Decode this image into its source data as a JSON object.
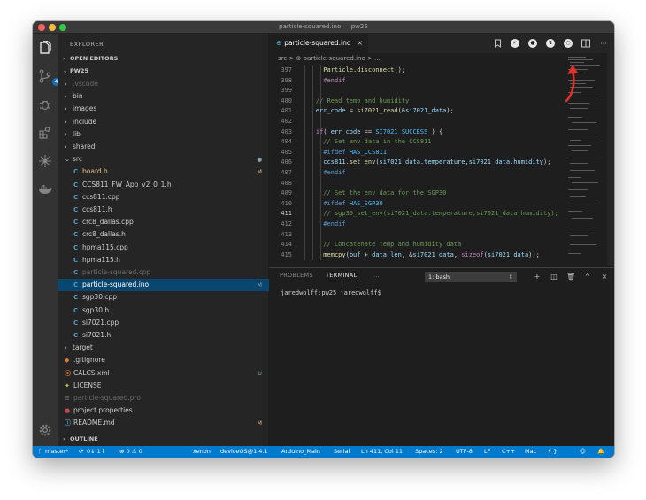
{
  "window": {
    "title": "particle-squared.ino — pw25"
  },
  "sidebar": {
    "header": "EXPLORER",
    "sections": {
      "open_editors": "OPEN EDITORS",
      "project": "PW25",
      "outline": "OUTLINE"
    },
    "tree": [
      {
        "name": ".vscode",
        "type": "folder",
        "muted": true
      },
      {
        "name": "bin",
        "type": "folder"
      },
      {
        "name": "images",
        "type": "folder"
      },
      {
        "name": "include",
        "type": "folder"
      },
      {
        "name": "lib",
        "type": "folder"
      },
      {
        "name": "shared",
        "type": "folder"
      },
      {
        "name": "src",
        "type": "folder-open",
        "status": "●"
      },
      {
        "name": "board.h",
        "type": "c",
        "status": "M",
        "modified": true
      },
      {
        "name": "CCS811_FW_App_v2_0_1.h",
        "type": "c"
      },
      {
        "name": "ccs811.cpp",
        "type": "c"
      },
      {
        "name": "ccs811.h",
        "type": "c"
      },
      {
        "name": "crc8_dallas.cpp",
        "type": "c"
      },
      {
        "name": "crc8_dallas.h",
        "type": "c"
      },
      {
        "name": "hpma115.cpp",
        "type": "c"
      },
      {
        "name": "hpma115.h",
        "type": "c"
      },
      {
        "name": "particle-squared.cpp",
        "type": "c",
        "muted": true
      },
      {
        "name": "particle-squared.ino",
        "type": "c",
        "status": "M",
        "selected": true
      },
      {
        "name": "sgp30.cpp",
        "type": "c"
      },
      {
        "name": "sgp30.h",
        "type": "c"
      },
      {
        "name": "si7021.cpp",
        "type": "c"
      },
      {
        "name": "si7021.h",
        "type": "c"
      },
      {
        "name": "target",
        "type": "folder"
      },
      {
        "name": ".gitignore",
        "type": "git"
      },
      {
        "name": "CALCS.xml",
        "type": "xml",
        "status": "U"
      },
      {
        "name": "LICENSE",
        "type": "license"
      },
      {
        "name": "particle-squared.pro",
        "type": "other",
        "muted": true
      },
      {
        "name": "project.properties",
        "type": "props"
      },
      {
        "name": "README.md",
        "type": "md",
        "status": "M"
      }
    ]
  },
  "editor": {
    "tab": {
      "label": "particle-squared.ino",
      "close": "×"
    },
    "breadcrumb": "src > ⊕ particle-squared.ino > ...",
    "lines": [
      {
        "n": "397",
        "segs": [
          [
            "tx",
            "      "
          ],
          [
            "fn",
            "Particle.disconnect"
          ],
          [
            "tx",
            "();"
          ]
        ]
      },
      {
        "n": "398",
        "segs": [
          [
            "tx",
            "      "
          ],
          [
            "kw",
            "#endif"
          ]
        ]
      },
      {
        "n": "399",
        "segs": [
          [
            "tx",
            ""
          ]
        ]
      },
      {
        "n": "400",
        "segs": [
          [
            "tx",
            "    "
          ],
          [
            "cm",
            "// Read temp and humidity"
          ]
        ]
      },
      {
        "n": "401",
        "segs": [
          [
            "tx",
            "    "
          ],
          [
            "id",
            "err_code"
          ],
          [
            "tx",
            " = "
          ],
          [
            "fn",
            "si7021_read"
          ],
          [
            "tx",
            "(&"
          ],
          [
            "id",
            "si7021_data"
          ],
          [
            "tx",
            ");"
          ]
        ]
      },
      {
        "n": "402",
        "segs": [
          [
            "tx",
            ""
          ]
        ]
      },
      {
        "n": "403",
        "segs": [
          [
            "tx",
            "    "
          ],
          [
            "kw",
            "if"
          ],
          [
            "tx",
            "( "
          ],
          [
            "id",
            "err_code"
          ],
          [
            "tx",
            " == "
          ],
          [
            "mc",
            "SI7021_SUCCESS"
          ],
          [
            "tx",
            " ) {"
          ]
        ]
      },
      {
        "n": "404",
        "segs": [
          [
            "tx",
            "      "
          ],
          [
            "cm",
            "// Set env data in the CCS811"
          ]
        ]
      },
      {
        "n": "405",
        "segs": [
          [
            "tx",
            "      "
          ],
          [
            "pp",
            "#ifdef"
          ],
          [
            "tx",
            " "
          ],
          [
            "mc",
            "HAS_CCS811"
          ]
        ]
      },
      {
        "n": "406",
        "segs": [
          [
            "tx",
            "      "
          ],
          [
            "id",
            "ccs811"
          ],
          [
            "tx",
            "."
          ],
          [
            "fn",
            "set_env"
          ],
          [
            "tx",
            "("
          ],
          [
            "id",
            "si7021_data"
          ],
          [
            "tx",
            "."
          ],
          [
            "id",
            "temperature"
          ],
          [
            "tx",
            ","
          ],
          [
            "id",
            "si7021_data"
          ],
          [
            "tx",
            "."
          ],
          [
            "id",
            "humidity"
          ],
          [
            "tx",
            ");"
          ]
        ]
      },
      {
        "n": "407",
        "segs": [
          [
            "tx",
            "      "
          ],
          [
            "pp",
            "#endif"
          ]
        ]
      },
      {
        "n": "408",
        "segs": [
          [
            "tx",
            ""
          ]
        ]
      },
      {
        "n": "409",
        "segs": [
          [
            "tx",
            "      "
          ],
          [
            "cm",
            "// Set the env data for the SGP30"
          ]
        ]
      },
      {
        "n": "410",
        "segs": [
          [
            "tx",
            "      "
          ],
          [
            "pp",
            "#ifdef"
          ],
          [
            "tx",
            " "
          ],
          [
            "mc",
            "HAS_SGP30"
          ]
        ]
      },
      {
        "n": "411",
        "segs": [
          [
            "tx",
            "      "
          ],
          [
            "cm",
            "// sgp30_set_env(si7021_data.temperature,si7021_data.humidity);"
          ]
        ],
        "active": true
      },
      {
        "n": "412",
        "segs": [
          [
            "tx",
            "      "
          ],
          [
            "pp",
            "#endif"
          ]
        ]
      },
      {
        "n": "413",
        "segs": [
          [
            "tx",
            ""
          ]
        ]
      },
      {
        "n": "414",
        "segs": [
          [
            "tx",
            "      "
          ],
          [
            "cm",
            "// Concatenate temp and humidity data"
          ]
        ]
      },
      {
        "n": "415",
        "segs": [
          [
            "tx",
            "      "
          ],
          [
            "fn",
            "memcpy"
          ],
          [
            "tx",
            "("
          ],
          [
            "id",
            "buf"
          ],
          [
            "tx",
            " + "
          ],
          [
            "id",
            "data_len"
          ],
          [
            "tx",
            ", &"
          ],
          [
            "id",
            "si7021_data"
          ],
          [
            "tx",
            ", "
          ],
          [
            "kw",
            "sizeof"
          ],
          [
            "tx",
            "("
          ],
          [
            "id",
            "si7021_data"
          ],
          [
            "tx",
            "));"
          ]
        ]
      }
    ]
  },
  "panel": {
    "tabs": [
      "PROBLEMS",
      "TERMINAL",
      "..."
    ],
    "terminal_select": "1: bash",
    "terminal_caret": "⇕",
    "prompt": "jaredwolff:pw25 jaredwolff$"
  },
  "statusbar": {
    "branch": "master*",
    "sync": "0↓ 1↑",
    "problems": "⊗ 0 ⚠ 0",
    "items": [
      "xenon",
      "deviceOS@1.4.1",
      "Arduino_Main",
      "Serial",
      "Ln 411, Col 11",
      "Spaces: 2",
      "UTF-8",
      "LF",
      "C++",
      "Mac",
      "{ }"
    ]
  },
  "colors": {
    "statusbar": "#007acc",
    "selection": "#094771",
    "accent_arrow": "#e0302b"
  }
}
